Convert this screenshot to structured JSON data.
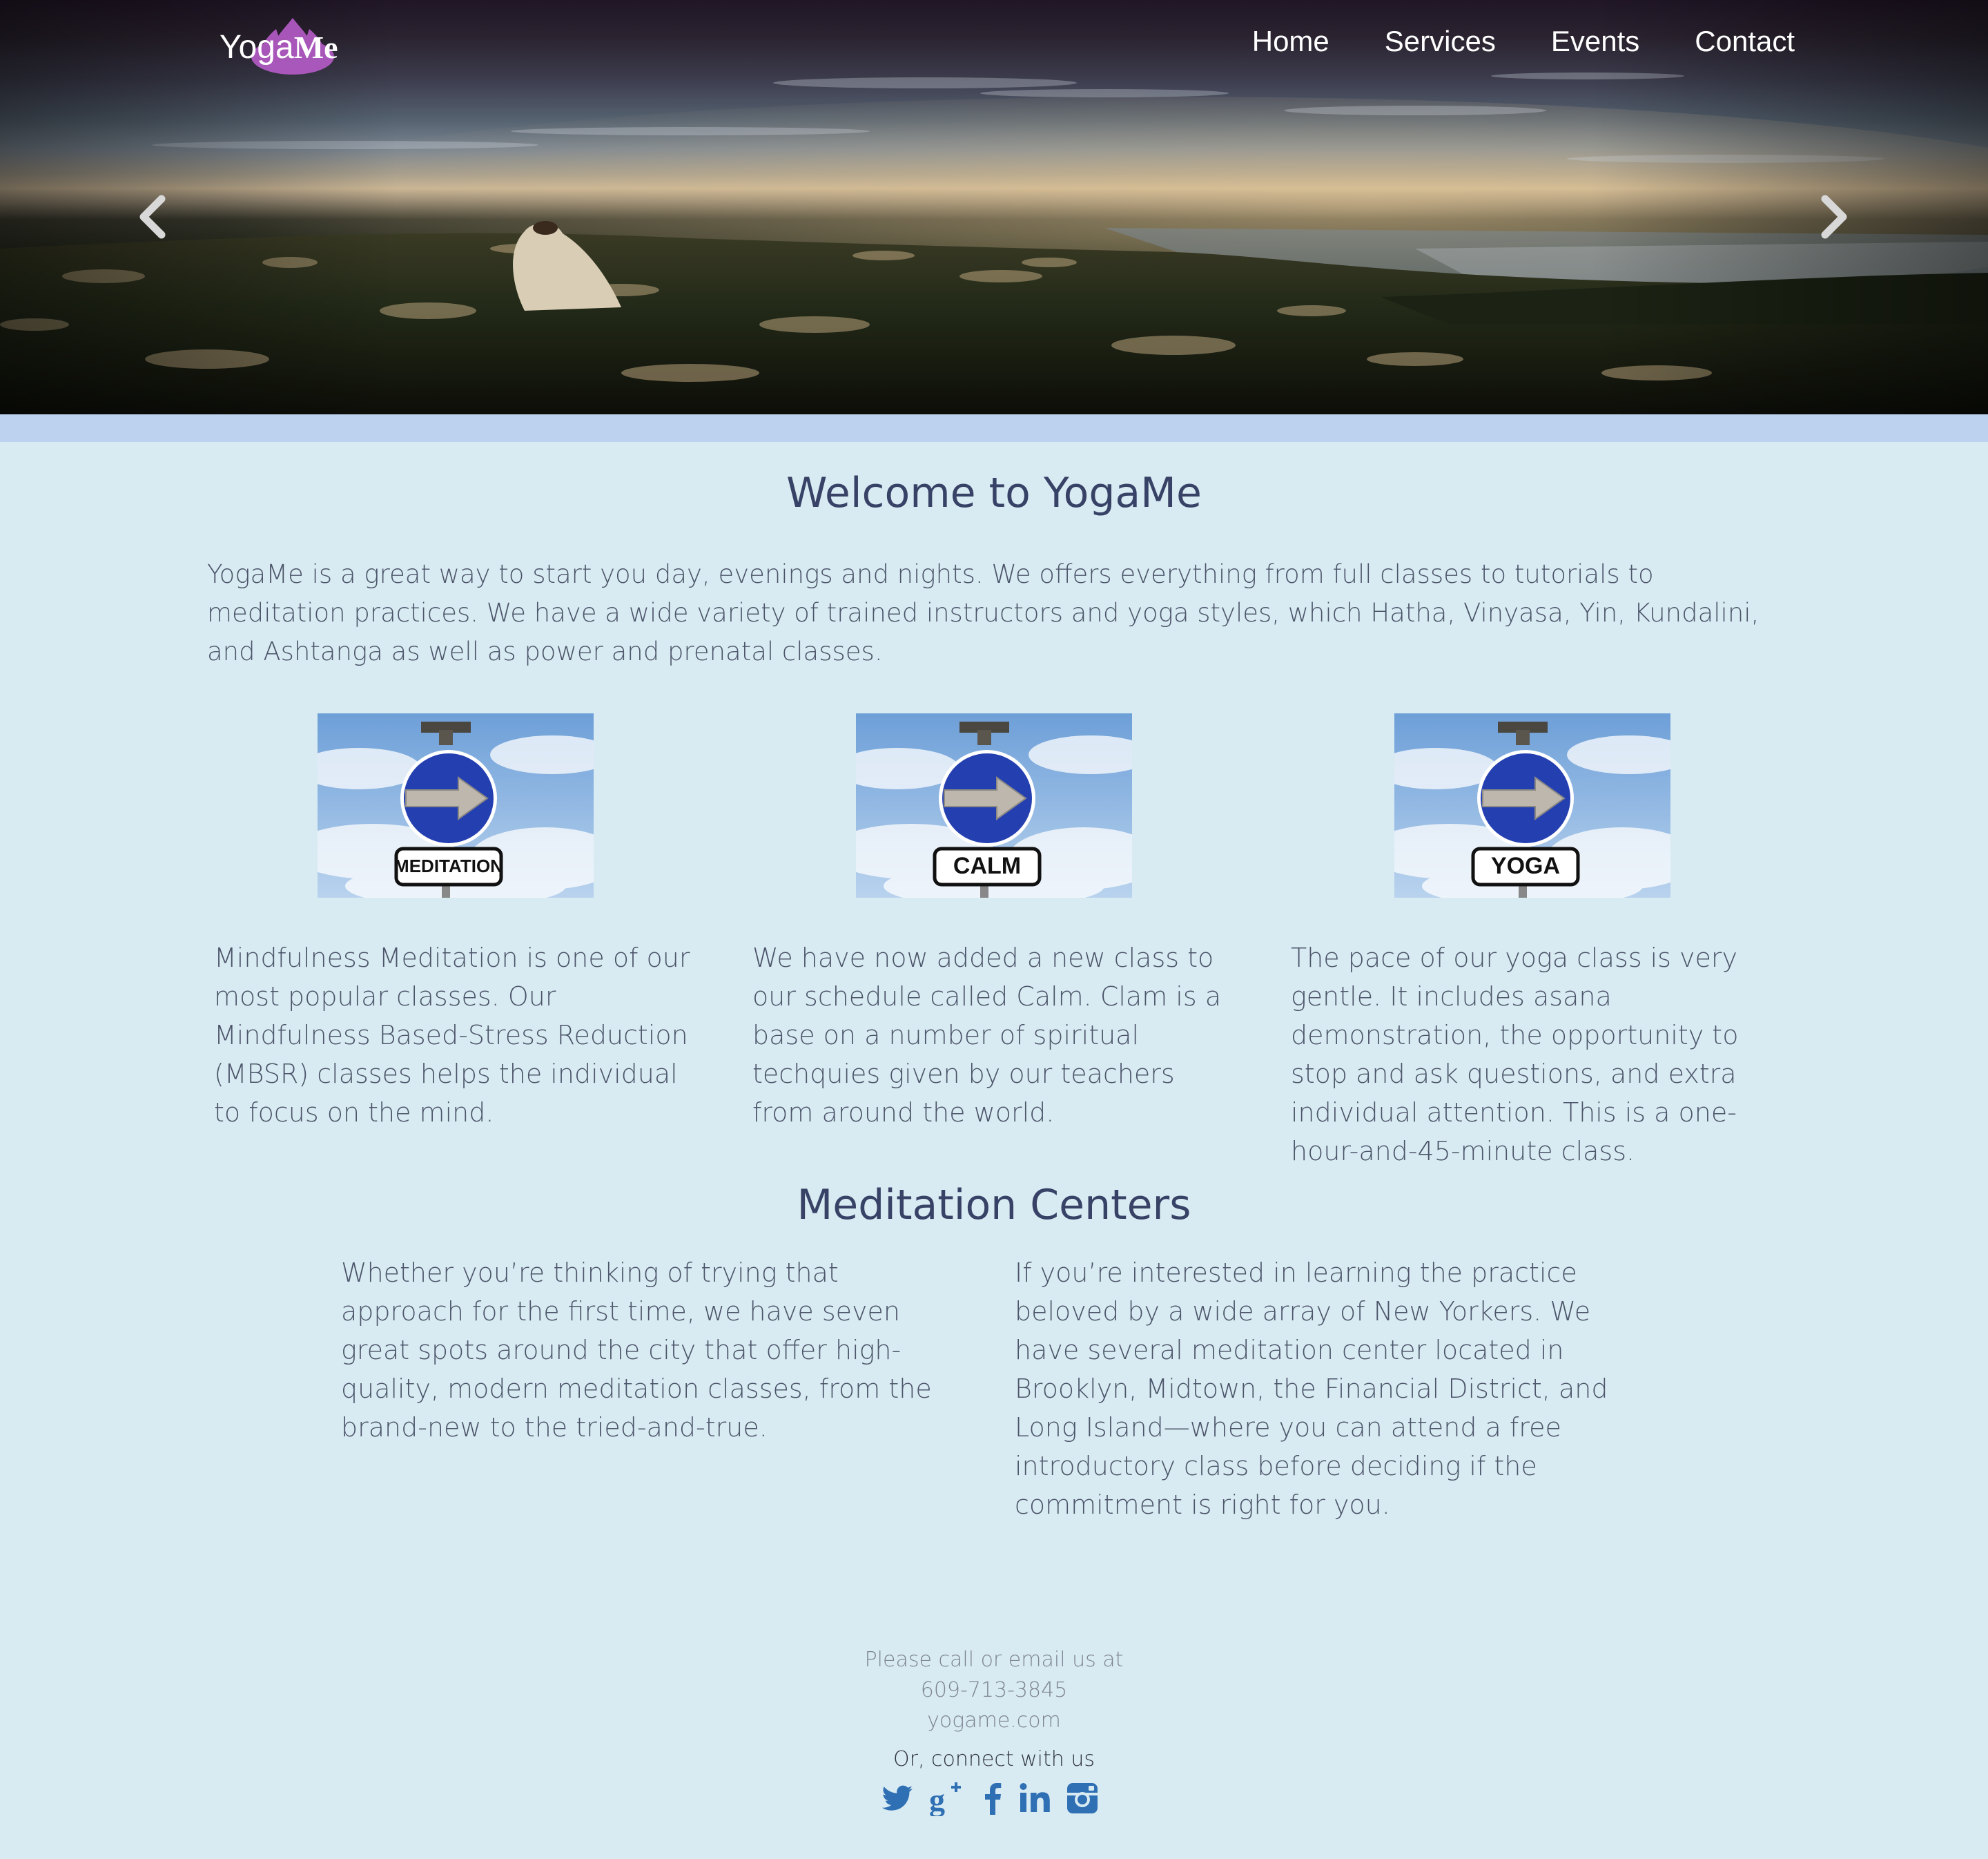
{
  "brand": {
    "logo_regular": "Yoga",
    "logo_bold": "Me"
  },
  "nav": {
    "items": [
      {
        "label": "Home"
      },
      {
        "label": "Services"
      },
      {
        "label": "Events"
      },
      {
        "label": "Contact"
      }
    ]
  },
  "carousel": {
    "prev_icon": "chevron-left-icon",
    "next_icon": "chevron-right-icon"
  },
  "welcome": {
    "title": "Welcome to YogaMe",
    "intro": "YogaMe is a great way to start you day, evenings and nights. We offers everything from full classes to tutorials to meditation practices. We have a wide variety of trained instructors and yoga styles, which Hatha, Vinyasa, Yin, Kundalini, and Ashtanga as well as power and prenatal classes."
  },
  "cards": [
    {
      "sign_label": "MEDITATION",
      "text": "Mindfulness Meditation is one of our most popular classes. Our Mindfulness Based-Stress Reduction (MBSR) classes helps the individual to focus on the mind."
    },
    {
      "sign_label": "CALM",
      "text": "We have now added a new class to our schedule called Calm. Clam is a base on a number of spiritual techquies given by our teachers from around the world."
    },
    {
      "sign_label": "YOGA",
      "text": "The pace of our yoga class is very gentle. It includes asana demonstration, the opportunity to stop and ask questions, and extra individual attention. This is a one-hour-and-45-minute class."
    }
  ],
  "centers": {
    "title": "Meditation Centers",
    "left": "Whether you’re thinking of trying that approach for the first time, we have seven great spots around the city that offer high-quality, modern meditation classes, from the brand-new to the tried-and-true.",
    "right": "If you’re interested in learning the practice beloved by a wide array of New Yorkers. We have several meditation center located in Brooklyn, Midtown, the Financial District, and Long Island—where you can attend a free introductory class before deciding if the commitment is right for you."
  },
  "footer": {
    "line1": "Please call or email us at",
    "phone": "609-713-3845",
    "website": "yogame.com",
    "connect": "Or, connect with us",
    "social_color": "#2f6fb3",
    "socials": [
      "twitter-icon",
      "google-plus-icon",
      "facebook-icon",
      "linkedin-icon",
      "instagram-icon"
    ]
  },
  "colors": {
    "page_background": "#d9ebf2",
    "strip": "#bcd2ef",
    "heading": "#384267",
    "body_text": "#4c556a",
    "logo_lotus": "#b65cc8"
  }
}
